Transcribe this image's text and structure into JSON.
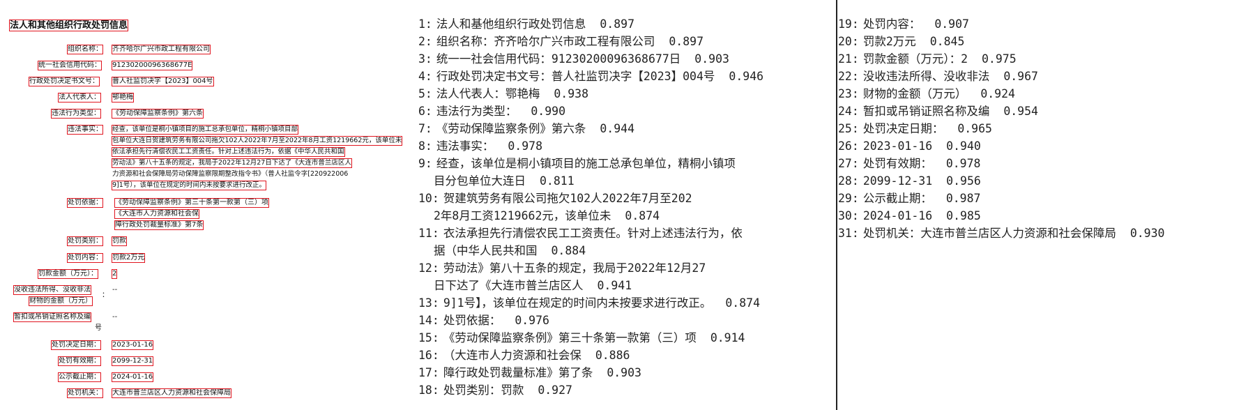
{
  "doc": {
    "title": "法人和其他组织行政处罚信息",
    "fields": [
      {
        "label": "组织名称：",
        "value": "齐齐哈尔广兴市政工程有限公司"
      },
      {
        "label": "统一社会信用代码：",
        "value": "91230200096368677E"
      },
      {
        "label": "行政处罚决定书文号：",
        "value": "普人社监罚决字【2023】004号"
      },
      {
        "label": "法人代表人：",
        "value": "鄂艳梅"
      },
      {
        "label": "违法行为类型：",
        "value": "《劳动保障监察条例》第六条"
      },
      {
        "label": "违法事实：",
        "value": ""
      },
      {
        "label": "处罚依据：",
        "value": ""
      },
      {
        "label": "处罚类别：",
        "value": "罚款"
      },
      {
        "label": "处罚内容：",
        "value": "罚款2万元"
      },
      {
        "label": "罚款金额（万元）：",
        "value": "2"
      },
      {
        "label": "没收违法所得、没收非法",
        "value": "--"
      },
      {
        "label": "财物的金额（万元）",
        "value": ""
      },
      {
        "label": "暂扣或吊销证照名称及编",
        "value": "--"
      },
      {
        "label": "号",
        "value": ""
      },
      {
        "label": "处罚决定日期：",
        "value": "2023-01-16"
      },
      {
        "label": "处罚有效期：",
        "value": "2099-12-31"
      },
      {
        "label": "公示截止期：",
        "value": "2024-01-16"
      },
      {
        "label": "处罚机关：",
        "value": "大连市普兰店区人力资源和社会保障局"
      }
    ],
    "facts_lines": [
      "经查，该单位是桐小镇项目的施工总承包单位，精桐小镇项目部",
      "包单位大连日贺建筑劳务有限公司拖欠102人2022年7月至2022年8月工资1219662元，该单位未",
      "依法承担先行清偿农民工工资责任。针对上述违法行为，依据《中华人民共和国",
      "劳动法》第八十五条的规定，我局于2022年12月27日下达了《大连市普兰店区人",
      "力资源和社会保障局劳动保障监察限期整改指令书》（普人社监令字[220922006",
      "9]1号），该单位在规定的时间内未按要求进行改正。"
    ],
    "basis_lines": [
      "《劳动保障监察条例》第三十条第一款第（三）项",
      "《大连市人力资源和社会保",
      "障行政处罚裁量标准》第7条"
    ],
    "colon": "："
  },
  "ocr": {
    "items": [
      {
        "n": "1:",
        "text": "法人和基他组织行政处罚信息",
        "score": "0.897"
      },
      {
        "n": "2:",
        "text": "组织名称：齐齐哈尔广兴市政工程有限公司",
        "score": "0.897"
      },
      {
        "n": "3:",
        "text": "统一一社会信用代码：91230200096368677日",
        "score": "0.903"
      },
      {
        "n": "4:",
        "text": "行政处罚决定书文号：普人社监罚决字【2023】004号",
        "score": "0.946"
      },
      {
        "n": "5:",
        "text": "法人代表人：鄂艳梅",
        "score": "0.938"
      },
      {
        "n": "6:",
        "text": "违法行为类型：",
        "score": "0.990"
      },
      {
        "n": "7:",
        "text": "《劳动保障监察条例》第六条",
        "score": "0.944"
      },
      {
        "n": "8:",
        "text": "违法事实：",
        "score": "0.978"
      },
      {
        "n": "9:",
        "text": "经查，该单位是桐小镇项目的施工总承包单位，精桐小镇项",
        "cont": "目分包单位大连日",
        "score": "0.811"
      },
      {
        "n": "10:",
        "text": "贺建筑劳务有限公司拖欠102人2022年7月至202",
        "cont": "2年8月工资1219662元，该单位未",
        "score": "0.874"
      },
      {
        "n": "11:",
        "text": "衣法承担先行清偿农民工工资责任。针对上述违法行为，依",
        "cont": "据（中华人民共和国",
        "score": "0.884"
      },
      {
        "n": "12:",
        "text": "劳动法》第八十五条的规定，我局于2022年12月27",
        "cont": "日下达了《大连市普兰店区人",
        "score": "0.941"
      },
      {
        "n": "13:",
        "text": "9]1号】，该单位在规定的时间内未按要求进行改正。",
        "score": "0.874"
      },
      {
        "n": "14:",
        "text": "处罚依据：",
        "score": "0.976"
      },
      {
        "n": "15:",
        "text": "《劳动保障监察条例》第三十条第一款第（三）项",
        "score": "0.914"
      },
      {
        "n": "16:",
        "text": "（大连市人力资源和社会保",
        "score": "0.886"
      },
      {
        "n": "17:",
        "text": "障行政处罚裁量标准》第了条",
        "score": "0.903"
      },
      {
        "n": "18:",
        "text": "处罚类别：罚款",
        "score": "0.927"
      },
      {
        "n": "19:",
        "text": "处罚内容：",
        "score": "0.907"
      },
      {
        "n": "20:",
        "text": "罚款2万元",
        "score": "0.845"
      },
      {
        "n": "21:",
        "text": "罚款金额（万元）：2",
        "score": "0.975"
      },
      {
        "n": "22:",
        "text": "没收违法所得、没收非法",
        "score": "0.967"
      },
      {
        "n": "23:",
        "text": "财物的金额（万元）",
        "score": "0.924"
      },
      {
        "n": "24:",
        "text": "暂扣或吊销证照名称及编",
        "score": "0.954"
      },
      {
        "n": "25:",
        "text": "处罚决定日期：",
        "score": "0.965"
      },
      {
        "n": "26:",
        "text": "2023-01-16",
        "score": "0.940"
      },
      {
        "n": "27:",
        "text": "处罚有效期：",
        "score": "0.978"
      },
      {
        "n": "28:",
        "text": "2099-12-31",
        "score": "0.956"
      },
      {
        "n": "29:",
        "text": "公示截止期：",
        "score": "0.987"
      },
      {
        "n": "30:",
        "text": "2024-01-16",
        "score": "0.985"
      },
      {
        "n": "31:",
        "text": "处罚机关：大连市普兰店区人力资源和社会保障局",
        "score": "0.930"
      }
    ]
  }
}
